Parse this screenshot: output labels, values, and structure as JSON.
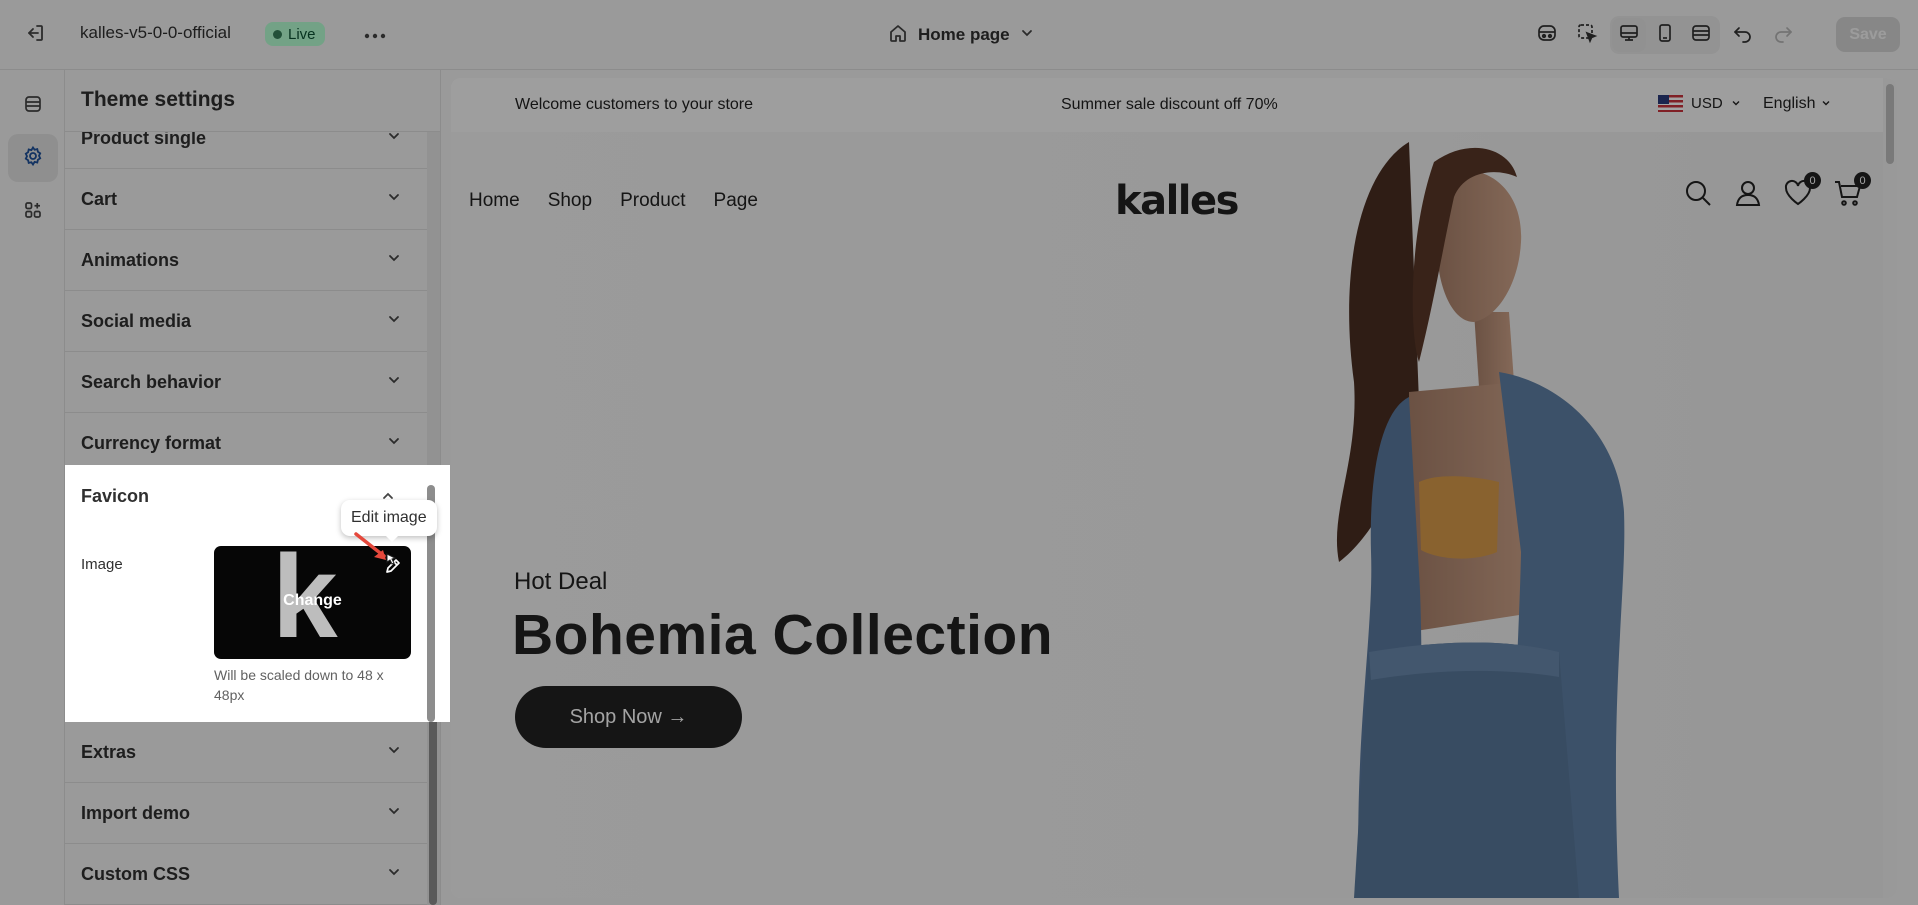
{
  "topbar": {
    "store_name": "kalles-v5-0-0-official",
    "status": "Live",
    "page_selector": "Home page",
    "save_label": "Save"
  },
  "panel": {
    "title": "Theme settings",
    "sections": [
      {
        "label": "Product single"
      },
      {
        "label": "Cart"
      },
      {
        "label": "Animations"
      },
      {
        "label": "Social media"
      },
      {
        "label": "Search behavior"
      },
      {
        "label": "Currency format"
      },
      {
        "label": "Favicon"
      },
      {
        "label": "Extras"
      },
      {
        "label": "Import demo"
      },
      {
        "label": "Custom CSS"
      }
    ],
    "favicon": {
      "heading": "Favicon",
      "image_label": "Image",
      "change_label": "Change",
      "logo_letter": "k",
      "note": "Will be scaled down to 48 x 48px",
      "tooltip": "Edit image"
    }
  },
  "preview": {
    "announcement_left": "Welcome customers to your store",
    "announcement_center": "Summer sale discount off 70%",
    "currency": "USD",
    "language": "English",
    "nav": [
      "Home",
      "Shop",
      "Product",
      "Page"
    ],
    "logo": "kalles",
    "wishlist_count": "0",
    "cart_count": "0",
    "hero_kicker": "Hot Deal",
    "hero_title": "Bohemia Collection",
    "hero_button": "Shop Now →"
  },
  "colors": {
    "live_badge_bg": "#b4fed2",
    "live_badge_text": "#0c5132",
    "dark": "#222222",
    "annotation_arrow": "#e5483c"
  },
  "icons": [
    "exit-icon",
    "more-icon",
    "home-icon",
    "chevron-down-icon",
    "inspector-icon",
    "select-icon",
    "desktop-icon",
    "mobile-icon",
    "fullscreen-icon",
    "undo-icon",
    "redo-icon",
    "sections-icon",
    "settings-gear-icon",
    "apps-icon",
    "search-icon",
    "account-icon",
    "wishlist-heart-icon",
    "cart-icon",
    "edit-pencil-icon",
    "flag-icon"
  ]
}
